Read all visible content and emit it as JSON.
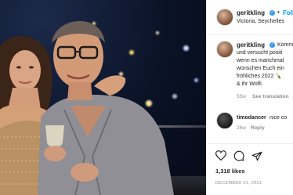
{
  "post": {
    "username": "geritkling",
    "follow_label": "Follow",
    "location": "Victoria, Seychelles",
    "caption_lines": [
      "Komm",
      "und versucht positi",
      "wenn es manchmal",
      "wünschen Euch ein",
      "fröhliches 2022 🍾",
      "& ihr Wolfi"
    ],
    "caption_age": "55w",
    "see_translation": "See translation",
    "comment": {
      "username": "timodancer",
      "text": "nice co",
      "age": "26w",
      "reply_label": "Reply"
    },
    "likes": "1,318 likes",
    "date": "DECEMBER 31, 2021"
  },
  "colors": {
    "verified": "#3897f0",
    "follow": "#0095f6",
    "muted": "#8e8e8e"
  },
  "icons": [
    "heart-icon",
    "comment-icon",
    "share-icon",
    "verified-badge-icon",
    "more-options-icon"
  ]
}
